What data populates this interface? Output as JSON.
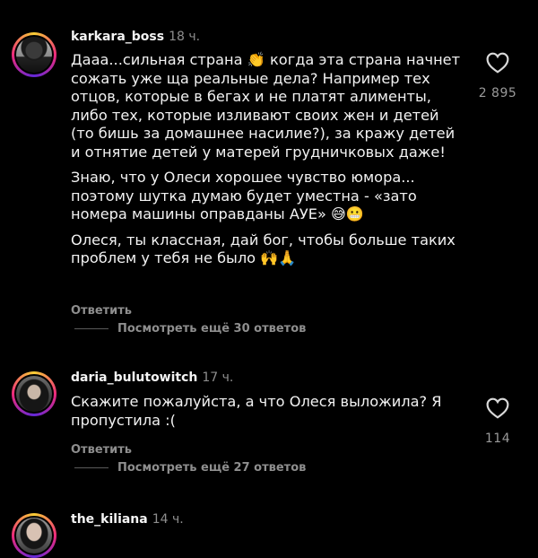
{
  "comments": [
    {
      "username": "karkara_boss",
      "time": "18 ч.",
      "paragraphs": [
        "Дааа...сильная страна 👏 когда эта страна начнет сожать уже ща реальные дела? Например тех отцов, которые в бегах и не платят алименты, либо тех, которые изливают своих жен и детей (то бишь за домашнее насилие?), за кражу детей и отнятие детей у матерей грудничковых даже!",
        "Знаю, что у Олеси хорошее чувство юмора... поэтому шутка думаю будет уместна - «зато номера машины оправданы АУЕ» 😅😬",
        "Олеся, ты классная, дай бог, чтобы больше таких проблем у тебя не было 🙌🙏"
      ],
      "reply_label": "Ответить",
      "view_replies": "Посмотреть ещё 30 ответов",
      "likes": "2 895"
    },
    {
      "username": "daria_bulutowitch",
      "time": "17 ч.",
      "paragraphs": [
        "Скажите пожалуйста, а что Олеся выложила? Я пропустила :("
      ],
      "reply_label": "Ответить",
      "view_replies": "Посмотреть ещё 27 ответов",
      "likes": "114"
    },
    {
      "username": "the_kiliana",
      "time": "14 ч.",
      "paragraphs": []
    }
  ],
  "colors": {
    "background": "#000000",
    "text": "#f2f2f2",
    "muted": "#8e8e8e",
    "story_ring": [
      "#f9ce34",
      "#ee2a7b",
      "#6228d7"
    ]
  },
  "icons": {
    "like": "heart-outline-icon"
  }
}
